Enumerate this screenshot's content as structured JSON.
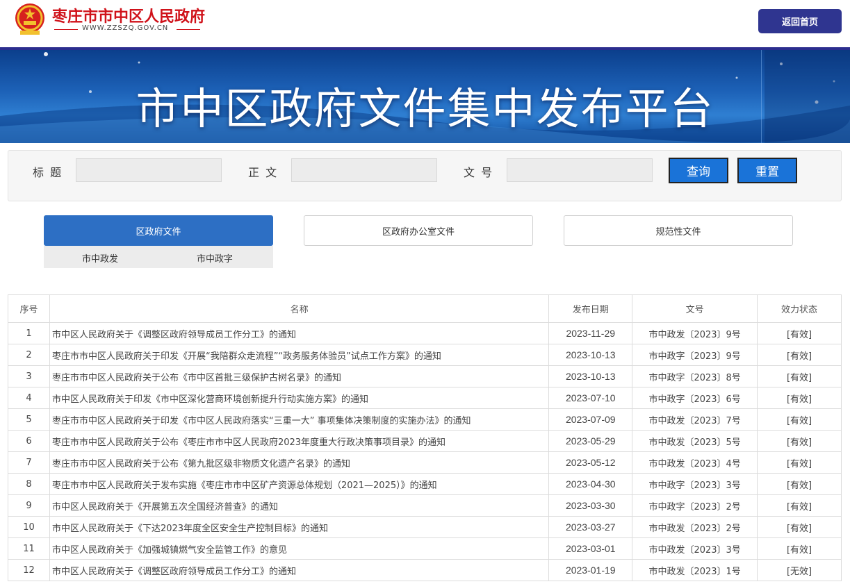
{
  "header": {
    "site_name": "枣庄市市中区人民政府",
    "site_url": "WWW.ZZSZQ.GOV.CN",
    "home_button": "返回首页"
  },
  "banner": {
    "title": "市中区政府文件集中发布平台"
  },
  "search": {
    "title_label": "标 题",
    "body_label": "正 文",
    "docno_label": "文 号",
    "title_value": "",
    "body_value": "",
    "docno_value": "",
    "query_button": "查询",
    "reset_button": "重置"
  },
  "tabs": [
    {
      "label": "区政府文件",
      "active": true
    },
    {
      "label": "区政府办公室文件",
      "active": false
    },
    {
      "label": "规范性文件",
      "active": false
    }
  ],
  "subtabs": [
    "市中政发",
    "市中政字"
  ],
  "table": {
    "headers": [
      "序号",
      "名称",
      "发布日期",
      "文号",
      "效力状态"
    ],
    "rows": [
      {
        "no": "1",
        "name": "市中区人民政府关于《调整区政府领导成员工作分工》的通知",
        "date": "2023-11-29",
        "docno": "市中政发〔2023〕9号",
        "status": "[有效]"
      },
      {
        "no": "2",
        "name": "枣庄市市中区人民政府关于印发《开展“我陪群众走流程”“政务服务体验员”试点工作方案》的通知",
        "date": "2023-10-13",
        "docno": "市中政字〔2023〕9号",
        "status": "[有效]"
      },
      {
        "no": "3",
        "name": "枣庄市市中区人民政府关于公布《市中区首批三级保护古树名录》的通知",
        "date": "2023-10-13",
        "docno": "市中政字〔2023〕8号",
        "status": "[有效]"
      },
      {
        "no": "4",
        "name": "市中区人民政府关于印发《市中区深化营商环境创新提升行动实施方案》的通知",
        "date": "2023-07-10",
        "docno": "市中政字〔2023〕6号",
        "status": "[有效]"
      },
      {
        "no": "5",
        "name": "枣庄市市中区人民政府关于印发《市中区人民政府落实“三重一大” 事项集体决策制度的实施办法》的通知",
        "date": "2023-07-09",
        "docno": "市中政发〔2023〕7号",
        "status": "[有效]"
      },
      {
        "no": "6",
        "name": "枣庄市市中区人民政府关于公布《枣庄市市中区人民政府2023年度重大行政决策事项目录》的通知",
        "date": "2023-05-29",
        "docno": "市中政发〔2023〕5号",
        "status": "[有效]"
      },
      {
        "no": "7",
        "name": "枣庄市市中区人民政府关于公布《第九批区级非物质文化遗产名录》的通知",
        "date": "2023-05-12",
        "docno": "市中政发〔2023〕4号",
        "status": "[有效]"
      },
      {
        "no": "8",
        "name": "枣庄市市中区人民政府关于发布实施《枣庄市市中区矿产资源总体规划（2021—2025）》的通知",
        "date": "2023-04-30",
        "docno": "市中政字〔2023〕3号",
        "status": "[有效]"
      },
      {
        "no": "9",
        "name": "市中区人民政府关于《开展第五次全国经济普查》的通知",
        "date": "2023-03-30",
        "docno": "市中政字〔2023〕2号",
        "status": "[有效]"
      },
      {
        "no": "10",
        "name": "市中区人民政府关于《下达2023年度全区安全生产控制目标》的通知",
        "date": "2023-03-27",
        "docno": "市中政发〔2023〕2号",
        "status": "[有效]"
      },
      {
        "no": "11",
        "name": "市中区人民政府关于《加强城镇燃气安全监管工作》的意见",
        "date": "2023-03-01",
        "docno": "市中政发〔2023〕3号",
        "status": "[有效]"
      },
      {
        "no": "12",
        "name": "市中区人民政府关于《调整区政府领导成员工作分工》的通知",
        "date": "2023-01-19",
        "docno": "市中政发〔2023〕1号",
        "status": "[无效]"
      }
    ]
  },
  "colors": {
    "brand_red": "#d0121a",
    "nav_blue": "#2f3590",
    "button_blue": "#1a73d8",
    "tab_active": "#2d6fc4"
  }
}
